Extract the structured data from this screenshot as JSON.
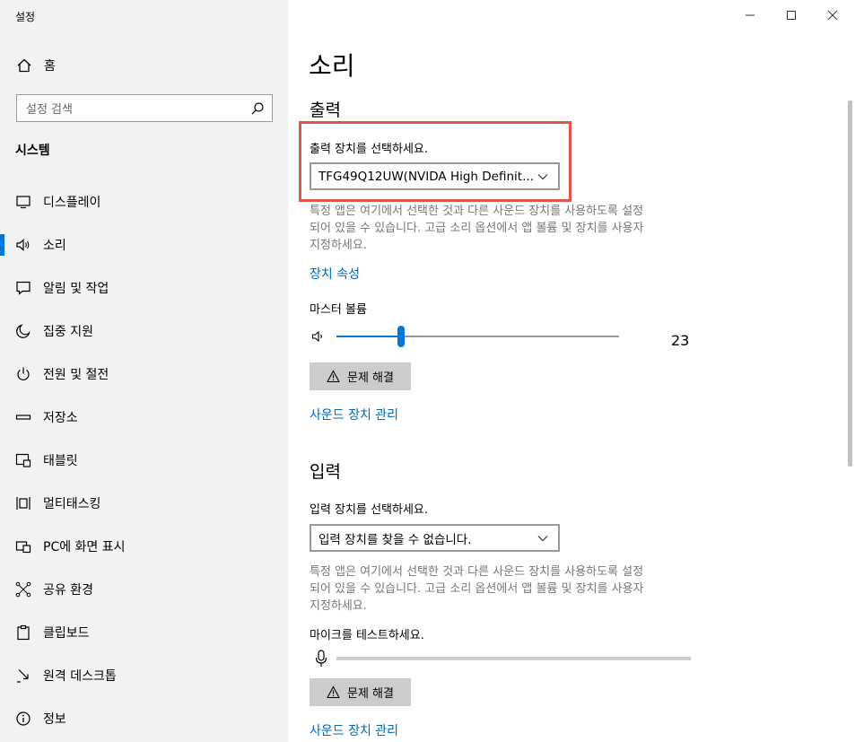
{
  "window": {
    "title": "설정"
  },
  "sidebar": {
    "home_label": "홈",
    "search_placeholder": "설정 검색",
    "section_header": "시스템",
    "items": [
      {
        "label": "디스플레이",
        "icon": "monitor-icon"
      },
      {
        "label": "소리",
        "icon": "speaker-icon",
        "active": true
      },
      {
        "label": "알림 및 작업",
        "icon": "notification-icon"
      },
      {
        "label": "집중 지원",
        "icon": "moon-icon"
      },
      {
        "label": "전원 및 절전",
        "icon": "power-icon"
      },
      {
        "label": "저장소",
        "icon": "storage-icon"
      },
      {
        "label": "태블릿",
        "icon": "tablet-icon"
      },
      {
        "label": "멀티태스킹",
        "icon": "multitasking-icon"
      },
      {
        "label": "PC에 화면 표시",
        "icon": "project-icon"
      },
      {
        "label": "공유 환경",
        "icon": "share-icon"
      },
      {
        "label": "클립보드",
        "icon": "clipboard-icon"
      },
      {
        "label": "원격 데스크톱",
        "icon": "remote-desktop-icon"
      },
      {
        "label": "정보",
        "icon": "info-icon"
      }
    ]
  },
  "main": {
    "title": "소리",
    "output": {
      "heading": "출력",
      "choose_label": "출력 장치를 선택하세요.",
      "device_value": "TFG49Q12UW(NVIDA High Definit...",
      "description_lines": [
        "특정 앱은 여기에서 선택한 것과 다른 사운드 장치를 사용하도록 설정",
        "되어 있을 수 있습니다. 고급 소리 옵션에서 앱 볼륨 및 장치를 사용자",
        "지정하세요."
      ],
      "device_properties_link": "장치 속성",
      "master_volume_label": "마스터 볼륨",
      "volume_value": "23",
      "volume_fraction": 0.23,
      "troubleshoot_label": "문제 해결",
      "manage_devices_link": "사운드 장치 관리"
    },
    "input": {
      "heading": "입력",
      "choose_label": "입력 장치를 선택하세요.",
      "device_value": "입력 장치를 찾을 수 없습니다.",
      "description_lines": [
        "특정 앱은 여기에서 선택한 것과 다른 사운드 장치를 사용하도록 설정",
        "되어 있을 수 있습니다. 고급 소리 옵션에서 앱 볼륨 및 장치를 사용자",
        "지정하세요."
      ],
      "mic_test_label": "마이크를 테스트하세요.",
      "troubleshoot_label": "문제 해결",
      "manage_devices_link": "사운드 장치 관리"
    }
  },
  "colors": {
    "accent": "#0067c0",
    "slider_blue": "#0078d7",
    "highlight": "#e0564b"
  }
}
